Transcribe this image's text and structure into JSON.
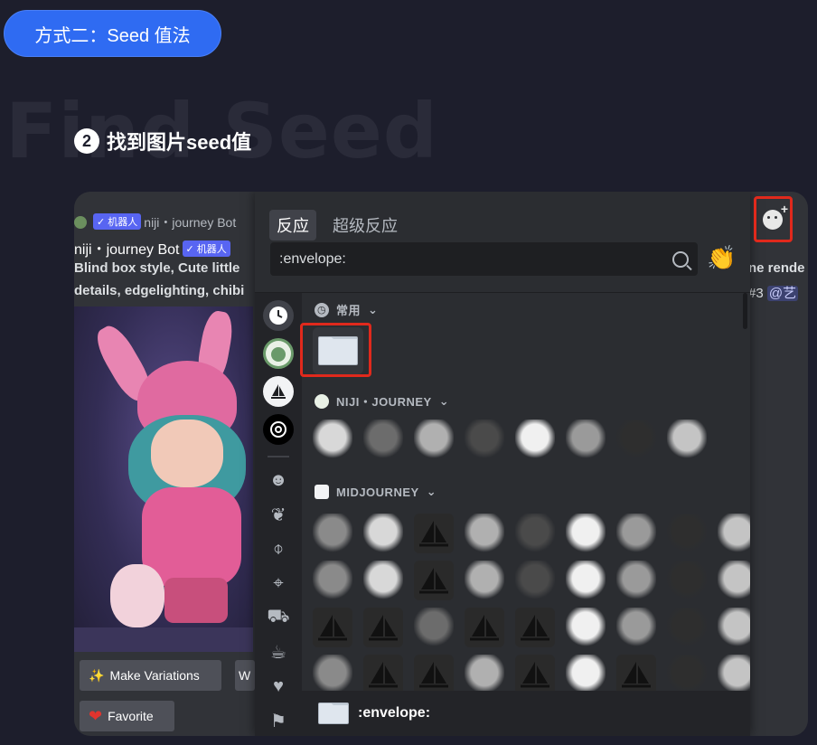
{
  "header": {
    "method_label": "方式二：Seed 值法",
    "watermark": "Find Seed"
  },
  "step": {
    "number": "2",
    "title": "找到图片seed值"
  },
  "background_message": {
    "bot_label_small": "niji・journey Bot",
    "badge": "✓ 机器人",
    "bot_name": "niji・journey Bot",
    "prompt_line1": "Blind box style, Cute little",
    "prompt_line2": "details, edgelighting, chibi",
    "right_text1": "ne rende",
    "right_text2": "#3",
    "right_mention": "@艺",
    "make_variations": "Make Variations",
    "cut_button": "W",
    "favorite": "Favorite"
  },
  "picker": {
    "tabs": [
      "反应",
      "超级反应"
    ],
    "search_value": ":envelope:",
    "sections": {
      "frequent": "常用",
      "niji": "NIJI・JOURNEY",
      "midjourney": "MIDJOURNEY"
    },
    "footer_label": ":envelope:"
  },
  "colors": {
    "accent": "#2f6bf2",
    "highlight": "#e0291c",
    "blurple": "#5865f2"
  }
}
